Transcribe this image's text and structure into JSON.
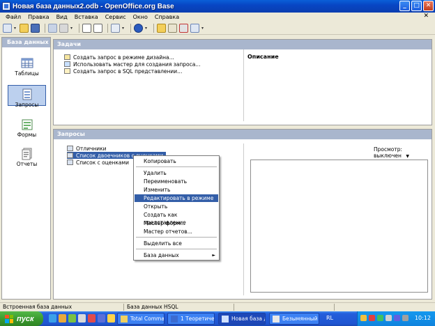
{
  "window": {
    "title": "Новая база данных2.odb - OpenOffice.org Base",
    "btn_min": "_",
    "btn_max": "□",
    "btn_close": "✕"
  },
  "menu": {
    "items": [
      "Файл",
      "Правка",
      "Вид",
      "Вставка",
      "Сервис",
      "Окно",
      "Справка"
    ],
    "close": "✕"
  },
  "sidebar": {
    "header": "База данных",
    "items": [
      {
        "label": "Таблицы",
        "icon": "table-icon"
      },
      {
        "label": "Запросы",
        "icon": "query-icon",
        "selected": true
      },
      {
        "label": "Формы",
        "icon": "form-icon"
      },
      {
        "label": "Отчеты",
        "icon": "report-icon"
      }
    ]
  },
  "tasks": {
    "header": "Задачи",
    "items": [
      "Создать запрос в режиме дизайна...",
      "Использовать мастер для создания запроса...",
      "Создать запрос в SQL представлении..."
    ],
    "description_title": "Описание"
  },
  "queries": {
    "header": "Запросы",
    "items": [
      "Отличники",
      "Список двоечников с оценками",
      "Список с оценками"
    ],
    "preview_label": "Просмотр: выключен",
    "preview_arrow": "▼"
  },
  "context_menu": {
    "items": [
      "Копировать",
      "Удалить",
      "Переименовать",
      "Изменить",
      "Редактировать в режиме SQL...",
      "Открыть",
      "Создать как представление",
      "Мастер форм...",
      "Мастер отчетов...",
      "Выделить все",
      "База данных"
    ],
    "highlighted": "Редактировать в режиме SQL...",
    "submenu_arrow": "►"
  },
  "statusbar": {
    "left": "Встроенная база данных",
    "middle": "База данных HSQL"
  },
  "taskbar": {
    "start": "пуск",
    "buttons": [
      "Total Comma...",
      "1 Теоретиче...",
      "Новая база д...",
      "Безымянный ..."
    ],
    "tray_text": "RL",
    "clock": "10:12"
  },
  "colors": {
    "accent": "#335ea8",
    "panel_header": "#a9b6cd",
    "taskbar": "#245edb",
    "start": "#3c9b2f"
  }
}
